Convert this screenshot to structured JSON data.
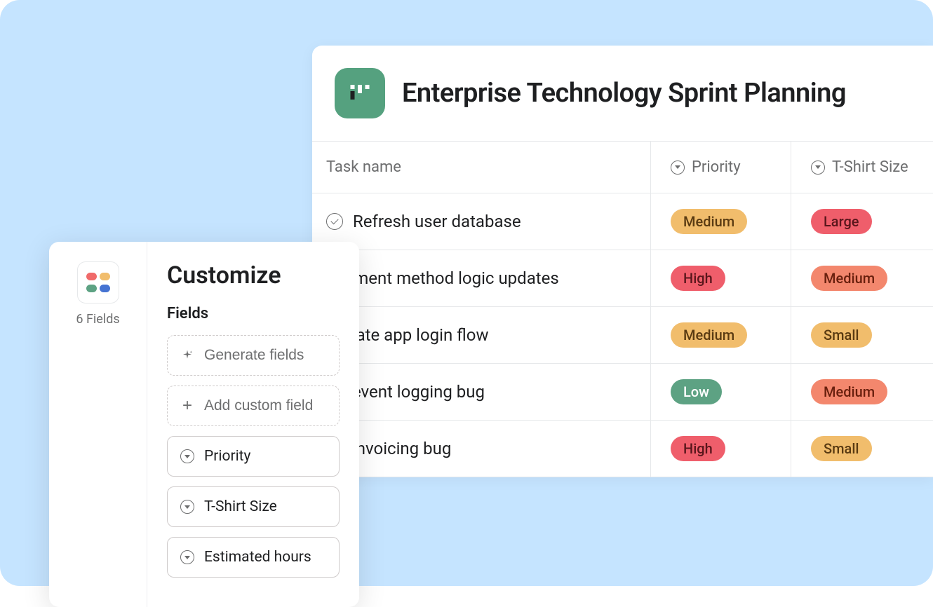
{
  "project": {
    "title": "Enterprise Technology Sprint Planning"
  },
  "table": {
    "columns": {
      "task": "Task name",
      "priority": "Priority",
      "size": "T-Shirt Size"
    },
    "rows": [
      {
        "task": "Refresh user database",
        "priority": "Medium",
        "priority_color": "yellow",
        "size": "Large",
        "size_color": "red"
      },
      {
        "task": "Payment method logic updates",
        "priority": "High",
        "priority_color": "red",
        "size": "Medium",
        "size_color": "orange"
      },
      {
        "task": "Update app login flow",
        "priority": "Medium",
        "priority_color": "yellow",
        "size": "Small",
        "size_color": "yellow"
      },
      {
        "task": "Fix event logging bug",
        "priority": "Low",
        "priority_color": "green",
        "size": "Medium",
        "size_color": "orange"
      },
      {
        "task": "Fix invoicing bug",
        "priority": "High",
        "priority_color": "red",
        "size": "Small",
        "size_color": "yellow"
      }
    ]
  },
  "customize": {
    "title": "Customize",
    "subtitle": "Fields",
    "count_label": "6 Fields",
    "generate_label": "Generate fields",
    "add_label": "Add custom field",
    "fields": [
      {
        "label": "Priority"
      },
      {
        "label": "T-Shirt Size"
      },
      {
        "label": "Estimated hours"
      }
    ]
  }
}
